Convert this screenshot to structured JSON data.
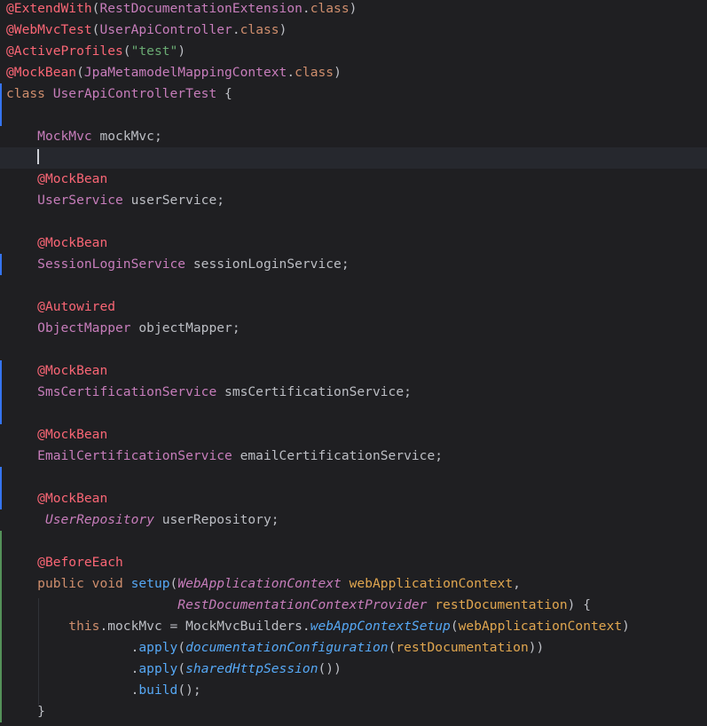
{
  "colors": {
    "background": "#1f1f22",
    "current_line": "#26282e",
    "gutter_modified": "#3574f0",
    "gutter_added": "#549159"
  },
  "code": [
    [
      {
        "t": "@ExtendWith",
        "c": "#fa6675"
      },
      {
        "t": "(",
        "c": "#bcbec4"
      },
      {
        "t": "RestDocumentationExtension",
        "c": "#c77dbb"
      },
      {
        "t": ".",
        "c": "#bcbec4"
      },
      {
        "t": "class",
        "c": "#cf8e6d"
      },
      {
        "t": ")",
        "c": "#bcbec4"
      }
    ],
    [
      {
        "t": "@WebMvcTest",
        "c": "#fa6675"
      },
      {
        "t": "(",
        "c": "#bcbec4"
      },
      {
        "t": "UserApiController",
        "c": "#c77dbb"
      },
      {
        "t": ".",
        "c": "#bcbec4"
      },
      {
        "t": "class",
        "c": "#cf8e6d"
      },
      {
        "t": ")",
        "c": "#bcbec4"
      }
    ],
    [
      {
        "t": "@ActiveProfiles",
        "c": "#fa6675"
      },
      {
        "t": "(",
        "c": "#bcbec4"
      },
      {
        "t": "\"test\"",
        "c": "#6aab73"
      },
      {
        "t": ")",
        "c": "#bcbec4"
      }
    ],
    [
      {
        "t": "@MockBean",
        "c": "#fa6675"
      },
      {
        "t": "(",
        "c": "#bcbec4"
      },
      {
        "t": "JpaMetamodelMappingContext",
        "c": "#c77dbb"
      },
      {
        "t": ".",
        "c": "#bcbec4"
      },
      {
        "t": "class",
        "c": "#cf8e6d"
      },
      {
        "t": ")",
        "c": "#bcbec4"
      }
    ],
    [
      {
        "t": "class ",
        "c": "#cf8e6d"
      },
      {
        "t": "UserApiControllerTest",
        "c": "#c77dbb"
      },
      {
        "t": " {",
        "c": "#bcbec4"
      }
    ],
    [],
    [
      {
        "t": "    "
      },
      {
        "t": "MockMvc",
        "c": "#c77dbb"
      },
      {
        "t": " mockMvc;",
        "c": "#bcbec4"
      }
    ],
    [
      {
        "t": "    "
      },
      {
        "caret": true
      }
    ],
    [
      {
        "t": "    "
      },
      {
        "t": "@MockBean",
        "c": "#fa6675"
      }
    ],
    [
      {
        "t": "    "
      },
      {
        "t": "UserService",
        "c": "#c77dbb"
      },
      {
        "t": " userService;",
        "c": "#bcbec4"
      }
    ],
    [],
    [
      {
        "t": "    "
      },
      {
        "t": "@MockBean",
        "c": "#fa6675"
      }
    ],
    [
      {
        "t": "    "
      },
      {
        "t": "SessionLoginService",
        "c": "#c77dbb"
      },
      {
        "t": " sessionLoginService;",
        "c": "#bcbec4"
      }
    ],
    [],
    [
      {
        "t": "    "
      },
      {
        "t": "@Autowired",
        "c": "#fa6675"
      }
    ],
    [
      {
        "t": "    "
      },
      {
        "t": "ObjectMapper",
        "c": "#c77dbb"
      },
      {
        "t": " objectMapper;",
        "c": "#bcbec4"
      }
    ],
    [],
    [
      {
        "t": "    "
      },
      {
        "t": "@MockBean",
        "c": "#fa6675"
      }
    ],
    [
      {
        "t": "    "
      },
      {
        "t": "SmsCertificationService",
        "c": "#c77dbb"
      },
      {
        "t": " smsCertificationService;",
        "c": "#bcbec4"
      }
    ],
    [],
    [
      {
        "t": "    "
      },
      {
        "t": "@MockBean",
        "c": "#fa6675"
      }
    ],
    [
      {
        "t": "    "
      },
      {
        "t": "EmailCertificationService",
        "c": "#c77dbb"
      },
      {
        "t": " emailCertificationService;",
        "c": "#bcbec4"
      }
    ],
    [],
    [
      {
        "t": "    "
      },
      {
        "t": "@MockBean",
        "c": "#fa6675"
      }
    ],
    [
      {
        "t": "     "
      },
      {
        "t": "UserRepository",
        "c": "#c77dbb",
        "i": true
      },
      {
        "t": " userRepository;",
        "c": "#bcbec4"
      }
    ],
    [],
    [
      {
        "t": "    "
      },
      {
        "t": "@BeforeEach",
        "c": "#fa6675"
      }
    ],
    [
      {
        "t": "    "
      },
      {
        "t": "public void ",
        "c": "#cf8e6d"
      },
      {
        "t": "setup",
        "c": "#56a8f5"
      },
      {
        "t": "(",
        "c": "#bcbec4"
      },
      {
        "t": "WebApplicationContext",
        "c": "#c77dbb",
        "i": true
      },
      {
        "t": " ",
        "c": "#bcbec4"
      },
      {
        "t": "webApplicationContext",
        "c": "#e0a64f"
      },
      {
        "t": ",",
        "c": "#bcbec4"
      }
    ],
    [
      {
        "t": "                      "
      },
      {
        "t": "RestDocumentationContextProvider",
        "c": "#c77dbb",
        "i": true
      },
      {
        "t": " ",
        "c": "#bcbec4"
      },
      {
        "t": "restDocumentation",
        "c": "#e0a64f"
      },
      {
        "t": ") {",
        "c": "#bcbec4"
      }
    ],
    [
      {
        "t": "        "
      },
      {
        "t": "this",
        "c": "#cf8e6d"
      },
      {
        "t": ".mockMvc = MockMvcBuilders.",
        "c": "#bcbec4"
      },
      {
        "t": "webAppContextSetup",
        "c": "#56a8f5",
        "i": true
      },
      {
        "t": "(",
        "c": "#bcbec4"
      },
      {
        "t": "webApplicationContext",
        "c": "#e0a64f"
      },
      {
        "t": ")",
        "c": "#bcbec4"
      }
    ],
    [
      {
        "t": "                "
      },
      {
        "t": ".",
        "c": "#bcbec4"
      },
      {
        "t": "apply",
        "c": "#56a8f5"
      },
      {
        "t": "(",
        "c": "#bcbec4"
      },
      {
        "t": "documentationConfiguration",
        "c": "#56a8f5",
        "i": true
      },
      {
        "t": "(",
        "c": "#bcbec4"
      },
      {
        "t": "restDocumentation",
        "c": "#e0a64f"
      },
      {
        "t": "))",
        "c": "#bcbec4"
      }
    ],
    [
      {
        "t": "                "
      },
      {
        "t": ".",
        "c": "#bcbec4"
      },
      {
        "t": "apply",
        "c": "#56a8f5"
      },
      {
        "t": "(",
        "c": "#bcbec4"
      },
      {
        "t": "sharedHttpSession",
        "c": "#56a8f5",
        "i": true
      },
      {
        "t": "())",
        "c": "#bcbec4"
      }
    ],
    [
      {
        "t": "                "
      },
      {
        "t": ".",
        "c": "#bcbec4"
      },
      {
        "t": "build",
        "c": "#56a8f5"
      },
      {
        "t": "();",
        "c": "#bcbec4"
      }
    ],
    [
      {
        "t": "    "
      },
      {
        "t": "}",
        "c": "#bcbec4"
      }
    ]
  ]
}
